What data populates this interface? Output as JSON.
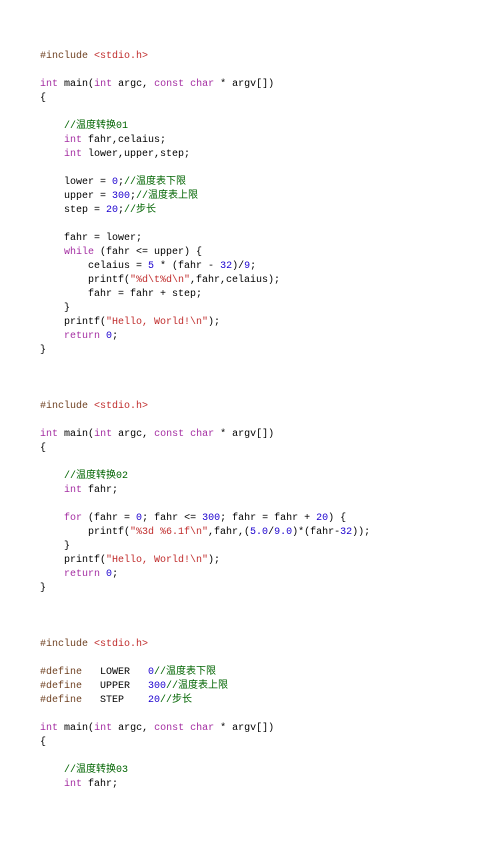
{
  "block1": {
    "l1_include": "#include",
    "l1_path": "<stdio.h>",
    "l2_kw1": "int",
    "l2_fn": "main",
    "l2_kw2": "int",
    "l2_argc": " argc, ",
    "l2_kw3": "const",
    "l2_mid": " ",
    "l2_kw4": "char",
    "l2_end": " * argv[])",
    "l3_brace": "{",
    "l4_cmt": "//温度转换01",
    "l5_kw": "int",
    "l5_txt": " fahr,celaius;",
    "l6_kw": "int",
    "l6_txt": " lower,upper,step;",
    "l7_txt1": "    lower = ",
    "l7_num": "0",
    "l7_txt2": ";",
    "l7_cmt": "//温度表下限",
    "l8_txt1": "    upper = ",
    "l8_num": "300",
    "l8_txt2": ";",
    "l8_cmt": "//温度表上限",
    "l9_txt1": "    step = ",
    "l9_num": "20",
    "l9_txt2": ";",
    "l9_cmt": "//步长",
    "l10_txt": "    fahr = lower;",
    "l11_kw": "while",
    "l11_txt": " (fahr <= upper) {",
    "l12_txt1": "        celaius = ",
    "l12_num1": "5",
    "l12_txt2": " * (fahr - ",
    "l12_num2": "32",
    "l12_txt3": ")/",
    "l12_num3": "9",
    "l12_txt4": ";",
    "l13_txt1": "        printf(",
    "l13_str": "\"%d\\t%d\\n\"",
    "l13_txt2": ",fahr,celaius);",
    "l14_txt": "        fahr = fahr + step;",
    "l15_txt": "    }",
    "l16_txt1": "    printf(",
    "l16_str": "\"Hello, World!\\n\"",
    "l16_txt2": ");",
    "l17_kw": "return",
    "l17_num": "0",
    "l17_txt": ";",
    "l18_brace": "}"
  },
  "block2": {
    "l1_include": "#include",
    "l1_path": "<stdio.h>",
    "l2_kw1": "int",
    "l2_fn": "main",
    "l2_kw2": "int",
    "l2_argc": " argc, ",
    "l2_kw3": "const",
    "l2_mid": " ",
    "l2_kw4": "char",
    "l2_end": " * argv[])",
    "l3_brace": "{",
    "l4_cmt": "//温度转换02",
    "l5_kw": "int",
    "l5_txt": " fahr;",
    "l6_kw": "for",
    "l6_txt1": " (fahr = ",
    "l6_num1": "0",
    "l6_txt2": "; fahr <= ",
    "l6_num2": "300",
    "l6_txt3": "; fahr = fahr + ",
    "l6_num3": "20",
    "l6_txt4": ") {",
    "l7_txt1": "        printf(",
    "l7_str": "\"%3d %6.1f\\n\"",
    "l7_txt2": ",fahr,(",
    "l7_num1": "5.0",
    "l7_txt3": "/",
    "l7_num2": "9.0",
    "l7_txt4": ")*(fahr-",
    "l7_num3": "32",
    "l7_txt5": "));",
    "l8_txt": "    }",
    "l9_txt1": "    printf(",
    "l9_str": "\"Hello, World!\\n\"",
    "l9_txt2": ");",
    "l10_kw": "return",
    "l10_num": "0",
    "l10_txt": ";",
    "l11_brace": "}"
  },
  "block3": {
    "l1_include": "#include",
    "l1_path": "<stdio.h>",
    "d1_kw": "#define",
    "d1_name": "   LOWER   ",
    "d1_num": "0",
    "d1_cmt": "//温度表下限",
    "d2_kw": "#define",
    "d2_name": "   UPPER   ",
    "d2_num": "300",
    "d2_cmt": "//温度表上限",
    "d3_kw": "#define",
    "d3_name": "   STEP    ",
    "d3_num": "20",
    "d3_cmt": "//步长",
    "l2_kw1": "int",
    "l2_fn": "main",
    "l2_kw2": "int",
    "l2_argc": " argc, ",
    "l2_kw3": "const",
    "l2_mid": " ",
    "l2_kw4": "char",
    "l2_end": " * argv[])",
    "l3_brace": "{",
    "l4_cmt": "//温度转换03",
    "l5_kw": "int",
    "l5_txt": " fahr;"
  }
}
